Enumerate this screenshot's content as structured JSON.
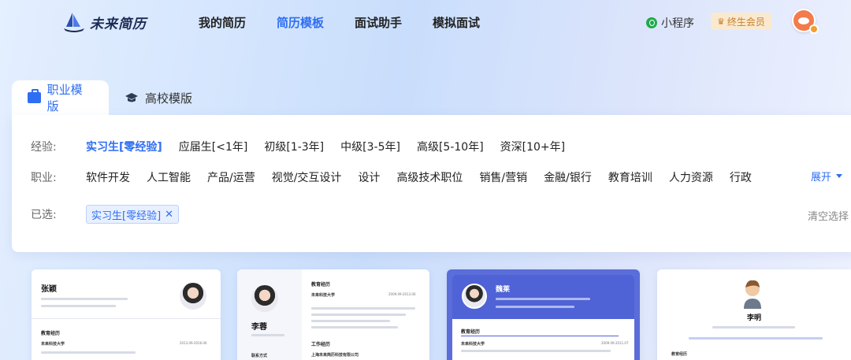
{
  "header": {
    "logo_text": "未来简历",
    "nav": [
      "我的简历",
      "简历模板",
      "面试助手",
      "模拟面试"
    ],
    "active_nav": 1,
    "mini_program": "小程序",
    "vip_label": "终生会员"
  },
  "tabs": [
    "职业模版",
    "高校模版"
  ],
  "filters": {
    "experience_label": "经验:",
    "experience_options": [
      "实习生[零经验]",
      "应届生[<1年]",
      "初级[1-3年]",
      "中级[3-5年]",
      "高级[5-10年]",
      "资深[10+年]"
    ],
    "career_label": "职业:",
    "career_options": [
      "软件开发",
      "人工智能",
      "产品/运营",
      "视觉/交互设计",
      "设计",
      "高级技术职位",
      "销售/营销",
      "金融/银行",
      "教育培训",
      "人力资源",
      "行政"
    ],
    "expand_label": "展开",
    "selected_label": "已选:",
    "selected_tag": "实习生[零经验]",
    "clear_label": "清空选择"
  },
  "cards": [
    {
      "name": "张颖",
      "section": "教育经历",
      "school": "未来科技大学",
      "date": "2013.09-2016.06"
    },
    {
      "name": "李蓉",
      "section": "教育经历",
      "school": "未来科技大学",
      "date": "2009.09-2013.06",
      "section2": "工作经历",
      "company": "上海未来简历科技有限公司",
      "section3": "联系方式"
    },
    {
      "name": "魏莱",
      "section": "教育经历",
      "school": "未来科技大学",
      "date": "2009.09-2011.07"
    },
    {
      "name": "李明",
      "section": "教育经历"
    }
  ],
  "colors": {
    "accent": "#2f6ef2",
    "card3_banner": "#4f63d6",
    "vip_text": "#c6812c"
  }
}
